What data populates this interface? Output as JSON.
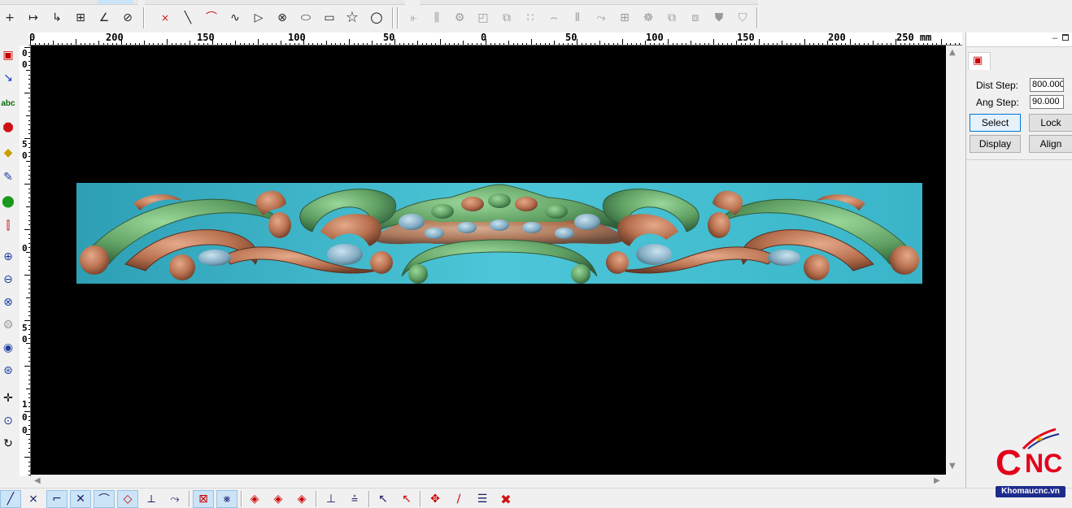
{
  "toolbar": {
    "icons": [
      "crosshair-icon",
      "dimension-icon",
      "offset-icon",
      "frame-icon",
      "angle-icon",
      "lasso-icon",
      "point-icon",
      "line-icon",
      "arc-icon",
      "spline-icon",
      "polyline-icon",
      "circle-point-icon",
      "ellipse-icon",
      "rectangle-icon",
      "star-icon",
      "circle-icon",
      "align-left-icon",
      "align-center-icon",
      "gear-node-icon",
      "weld-icon",
      "mirror-icon",
      "array-icon",
      "curve-nodes-icon",
      "bars-icon",
      "smooth-icon",
      "transform-icon",
      "node-edit-icon",
      "group-icon",
      "ungroup-icon",
      "shield-icon",
      "shield-fill-icon"
    ]
  },
  "ruler": {
    "unit": "mm",
    "h_labels": [
      "0",
      "200",
      "150",
      "100",
      "50",
      "0",
      "50",
      "100",
      "150",
      "200",
      "250 mm"
    ],
    "v_labels": [
      "0",
      "0",
      "5",
      "0",
      "0",
      "5",
      "0",
      "1",
      "0",
      "0"
    ]
  },
  "right_panel": {
    "dist_step_label": "Dist Step:",
    "dist_step_value": "800.000",
    "ang_step_label": "Ang Step:",
    "ang_step_value": "90.000",
    "select_label": "Select",
    "lock_label": "Lock",
    "display_label": "Display",
    "align_label": "Align"
  },
  "logo": {
    "letter_c": "C",
    "letters_nc": "NC",
    "site": "Khomaucnc.vn"
  },
  "colors": {
    "viewport_bg": "#000000",
    "relief_bg": "#3cb4c8",
    "relief_copper": "#c07a5a",
    "relief_green": "#6fa870",
    "logo_red": "#e3001b",
    "logo_blue": "#1d2c8c"
  }
}
